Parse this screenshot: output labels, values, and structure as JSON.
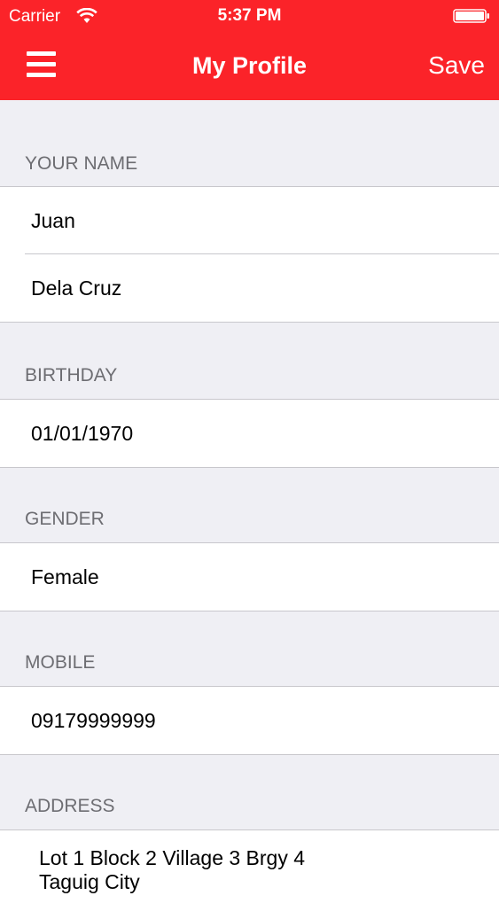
{
  "status_bar": {
    "carrier": "Carrier",
    "time": "5:37 PM",
    "wifi_icon": "wifi-icon",
    "battery_icon": "battery-icon"
  },
  "nav": {
    "title": "My Profile",
    "save_label": "Save",
    "menu_icon": "hamburger-menu-icon",
    "color": "#fb2329"
  },
  "sections": {
    "name": {
      "header": "YOUR NAME",
      "first_name": "Juan",
      "last_name": "Dela Cruz"
    },
    "birthday": {
      "header": "BIRTHDAY",
      "value": "01/01/1970"
    },
    "gender": {
      "header": "GENDER",
      "value": "Female"
    },
    "mobile": {
      "header": "MOBILE",
      "value": "09179999999"
    },
    "address": {
      "header": "ADDRESS",
      "value": "Lot 1 Block 2 Village 3 Brgy 4\nTaguig City"
    }
  }
}
